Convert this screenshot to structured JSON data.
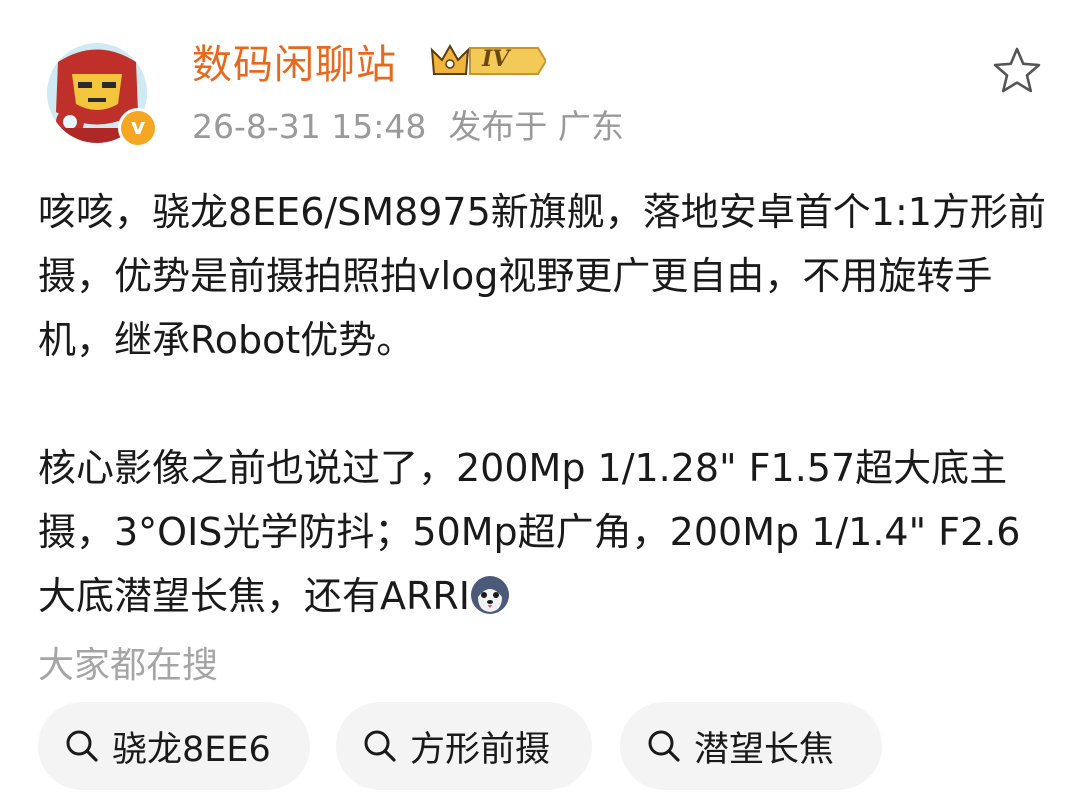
{
  "post": {
    "author": {
      "name": "数码闲聊站",
      "level": "IV",
      "verified_mark": "v",
      "avatar": "iron-man-avatar"
    },
    "timestamp": "26-8-31 15:48",
    "location": "发布于 广东",
    "paragraphs": [
      "咳咳，骁龙8EE6/SM8975新旗舰，落地安卓首个1:1方形前摄，优势是前摄拍照拍vlog视野更广更自由，不用旋转手机，继承Robot优势。",
      "核心影像之前也说过了，200Mp 1/1.28\" F1.57超大底主摄，3°OIS光学防抖；50Mp超广角，200Mp 1/1.4\" F2.6大底潜望长焦，还有ARRI"
    ],
    "inline_emoji": "husky-emoji"
  },
  "favorite_icon": "star-outline-icon",
  "search_section": {
    "title": "大家都在搜",
    "chips": [
      {
        "label": "骁龙8EE6",
        "icon": "search-icon"
      },
      {
        "label": "方形前摄",
        "icon": "search-icon"
      },
      {
        "label": "潜望长焦",
        "icon": "search-icon"
      }
    ]
  },
  "colors": {
    "author_name": "#e8691e",
    "verified_badge": "#f5a623",
    "meta_text": "#9a9a9a",
    "chip_background": "#f4f4f4"
  }
}
